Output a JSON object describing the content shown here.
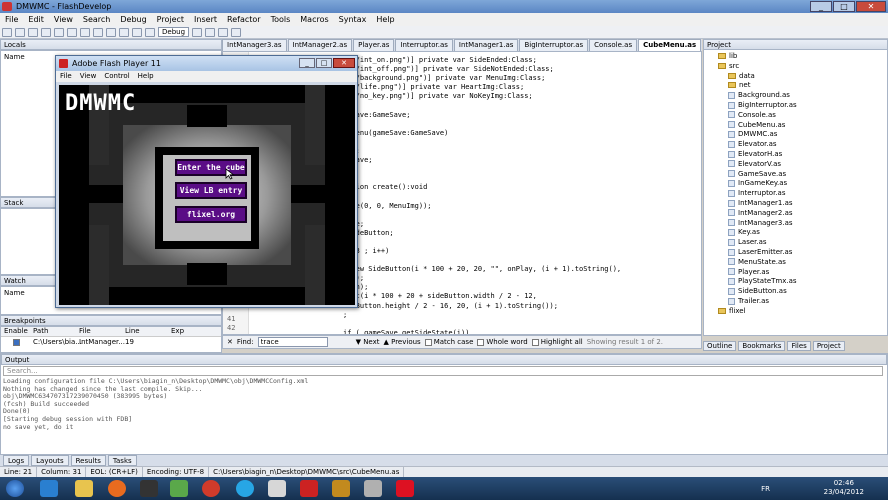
{
  "window": {
    "title": "DMWMC - FlashDevelop"
  },
  "menu": [
    "File",
    "Edit",
    "View",
    "Search",
    "Debug",
    "Project",
    "Insert",
    "Refactor",
    "Tools",
    "Macros",
    "Syntax",
    "Help"
  ],
  "toolbar": {
    "config": "Debug"
  },
  "tabs": [
    "IntManager3.as",
    "IntManager2.as",
    "Player.as",
    "Interruptor.as",
    "IntManager1.as",
    "BigInterruptor.as",
    "Console.as",
    "CubeMenu.as"
  ],
  "active_tab": "CubeMenu.as",
  "panels": {
    "locals": "Locals",
    "name_col": "Name",
    "stack": "Stack",
    "watch": "Watch",
    "watch_name": "Name",
    "breakpoints": "Breakpoints",
    "project": "Project"
  },
  "breakpoints": {
    "headers": [
      "Enable",
      "Path",
      "File",
      "Line",
      "Exp"
    ],
    "row": [
      "C:\\Users\\bia...",
      "IntManager...",
      "19",
      ""
    ]
  },
  "code_lines": [
    "ata/int_on.png\")] private var SideEnded:Class;",
    "ata/int_off.png\")] private var SideNotEnded:Class;",
    "ata/background.png\")] private var MenuImg:Class;",
    "ata/life.png\")] private var HeartImg:Class;",
    "ata/no_key.png\")] private var NoKeyImg:Class;",
    "",
    "meSave:GameSave;",
    "",
    "meMenu(gameSave:GameSave)",
    "",
    "w();",
    "meSave;",
    "",
    "",
    "nction create():void",
    "",
    "rite(0, 0, MenuImg));",
    "",
    "rite;",
    ":SideButton;",
    "",
    " < 3 ; i++)",
    "",
    "= new SideButton(i * 100 + 20, 20, \"\", onPlay, (i + 1).toString(),",
    "ave);",
    "tton);",
    "Text(i * 100 + 20 + sideButton.width / 2 - 12,",
    "ideButton.height / 2 - 16, 20, (i + 1).toString());",
    ";",
    "",
    "if (_gameSave.getSideState(i))",
    "  add (new FlxSprite(t.x - 20, t.y + 15, SideEnded));"
  ],
  "line_numbers": {
    "a": "41",
    "b": "42"
  },
  "find": {
    "label": "Find:",
    "value": "trace",
    "next": "Next",
    "previous": "Previous",
    "match_case": "Match case",
    "whole_word": "Whole word",
    "highlight_all": "Highlight all",
    "result": "Showing result 1 of 2."
  },
  "flash": {
    "title": "Adobe Flash Player 11",
    "menu": [
      "File",
      "View",
      "Control",
      "Help"
    ],
    "logo": "DMWMC",
    "btn1": "Enter the cube",
    "btn2": "View LB entry",
    "btn3": "flixel.org"
  },
  "project_tree": [
    {
      "label": "lib",
      "type": "folder",
      "indent": 1
    },
    {
      "label": "src",
      "type": "folder",
      "indent": 1
    },
    {
      "label": "data",
      "type": "folder",
      "indent": 2
    },
    {
      "label": "net",
      "type": "folder",
      "indent": 2
    },
    {
      "label": "Background.as",
      "type": "file",
      "indent": 2
    },
    {
      "label": "BigInterruptor.as",
      "type": "file",
      "indent": 2
    },
    {
      "label": "Console.as",
      "type": "file",
      "indent": 2
    },
    {
      "label": "CubeMenu.as",
      "type": "file",
      "indent": 2
    },
    {
      "label": "DMWMC.as",
      "type": "file",
      "indent": 2
    },
    {
      "label": "Elevator.as",
      "type": "file",
      "indent": 2
    },
    {
      "label": "ElevatorH.as",
      "type": "file",
      "indent": 2
    },
    {
      "label": "ElevatorV.as",
      "type": "file",
      "indent": 2
    },
    {
      "label": "GameSave.as",
      "type": "file",
      "indent": 2
    },
    {
      "label": "InGameKey.as",
      "type": "file",
      "indent": 2
    },
    {
      "label": "Interruptor.as",
      "type": "file",
      "indent": 2
    },
    {
      "label": "IntManager1.as",
      "type": "file",
      "indent": 2
    },
    {
      "label": "IntManager2.as",
      "type": "file",
      "indent": 2
    },
    {
      "label": "IntManager3.as",
      "type": "file",
      "indent": 2
    },
    {
      "label": "Key.as",
      "type": "file",
      "indent": 2
    },
    {
      "label": "Laser.as",
      "type": "file",
      "indent": 2
    },
    {
      "label": "LaserEmitter.as",
      "type": "file",
      "indent": 2
    },
    {
      "label": "MenuState.as",
      "type": "file",
      "indent": 2
    },
    {
      "label": "Player.as",
      "type": "file",
      "indent": 2
    },
    {
      "label": "PlayStateTmx.as",
      "type": "file",
      "indent": 2
    },
    {
      "label": "SideButton.as",
      "type": "file",
      "indent": 2
    },
    {
      "label": "Trailer.as",
      "type": "file",
      "indent": 2
    },
    {
      "label": "flixel",
      "type": "folder",
      "indent": 1
    }
  ],
  "project_tabs": [
    "Outline",
    "Bookmarks",
    "Files",
    "Project"
  ],
  "output": {
    "title": "Output",
    "search": "Search...",
    "lines": [
      "Loading configuration file C:\\Users\\biagin_n\\Desktop\\DMWMC\\obj\\DMWMCConfig.xml",
      "Nothing has changed since the last compile. Skip...",
      "obj\\DMWMC634707317239070450 (383995 bytes)",
      "(fcsh) Build succeeded",
      "Done(0)",
      "[Starting debug session with FDB]",
      "no save yet, do it"
    ]
  },
  "bottom_tabs": [
    "Logs",
    "Layouts",
    "Results",
    "Tasks"
  ],
  "status": [
    "Line: 21",
    "Column: 31",
    "EOL: (CR+LF)",
    "Encoding: UTF-8",
    "C:\\Users\\biagin_n\\Desktop\\DMWMC\\src\\CubeMenu.as"
  ],
  "taskbar": {
    "lang": "FR",
    "time": "02:46",
    "date": "23/04/2012"
  }
}
